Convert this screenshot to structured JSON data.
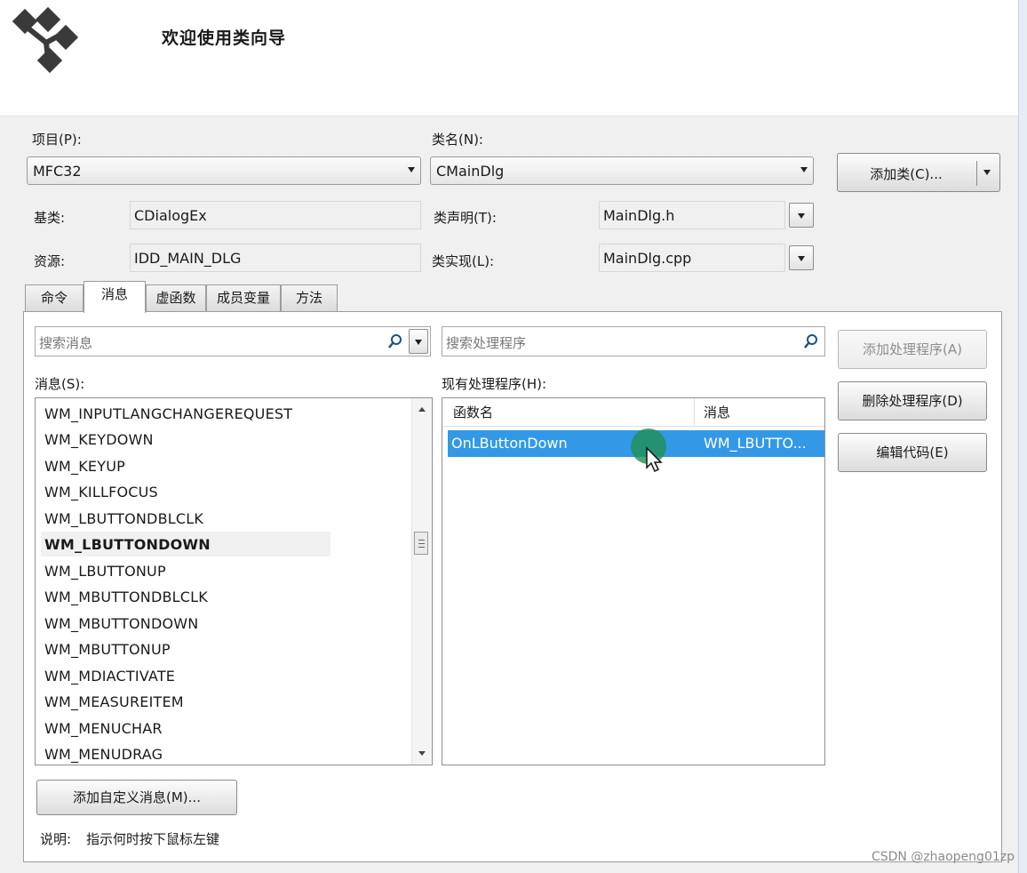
{
  "header": {
    "title": "欢迎使用类向导"
  },
  "project": {
    "label": "项目(P):",
    "value": "MFC32"
  },
  "classname": {
    "label": "类名(N):",
    "value": "CMainDlg"
  },
  "add_class_button": "添加类(C)...",
  "base_class": {
    "label": "基类:",
    "value": "CDialogEx"
  },
  "resource": {
    "label": "资源:",
    "value": "IDD_MAIN_DLG"
  },
  "class_decl": {
    "label": "类声明(T):",
    "value": "MainDlg.h"
  },
  "class_impl": {
    "label": "类实现(L):",
    "value": "MainDlg.cpp"
  },
  "tabs": [
    {
      "label": "命令"
    },
    {
      "label": "消息",
      "active": true
    },
    {
      "label": "虚函数"
    },
    {
      "label": "成员变量"
    },
    {
      "label": "方法"
    }
  ],
  "search_messages": {
    "placeholder": "搜索消息"
  },
  "search_handlers": {
    "placeholder": "搜索处理程序"
  },
  "messages": {
    "label": "消息(S):",
    "items": [
      "WM_INPUTLANGCHANGEREQUEST",
      "WM_KEYDOWN",
      "WM_KEYUP",
      "WM_KILLFOCUS",
      "WM_LBUTTONDBLCLK",
      "WM_LBUTTONDOWN",
      "WM_LBUTTONUP",
      "WM_MBUTTONDBLCLK",
      "WM_MBUTTONDOWN",
      "WM_MBUTTONUP",
      "WM_MDIACTIVATE",
      "WM_MEASUREITEM",
      "WM_MENUCHAR",
      "WM_MENUDRAG"
    ],
    "selected": "WM_LBUTTONDOWN"
  },
  "handlers": {
    "label": "现有处理程序(H):",
    "columns": [
      "函数名",
      "消息"
    ],
    "rows": [
      {
        "function": "OnLButtonDown",
        "message": "WM_LBUTTO..."
      }
    ]
  },
  "buttons": {
    "add_handler": "添加处理程序(A)",
    "delete_handler": "删除处理程序(D)",
    "edit_code": "编辑代码(E)",
    "add_custom_message": "添加自定义消息(M)..."
  },
  "description": {
    "label": "说明:",
    "text": "指示何时按下鼠标左键"
  },
  "watermark": "CSDN @zhaopeng01zp",
  "colors": {
    "selection": "#3399e6",
    "window_bg": "#f0f0f0",
    "cursor_highlight": "#1f8f55"
  },
  "icons": [
    "class-wizard-logo-icon",
    "search-icon",
    "dropdown-arrow-icon",
    "mouse-pointer-icon"
  ]
}
